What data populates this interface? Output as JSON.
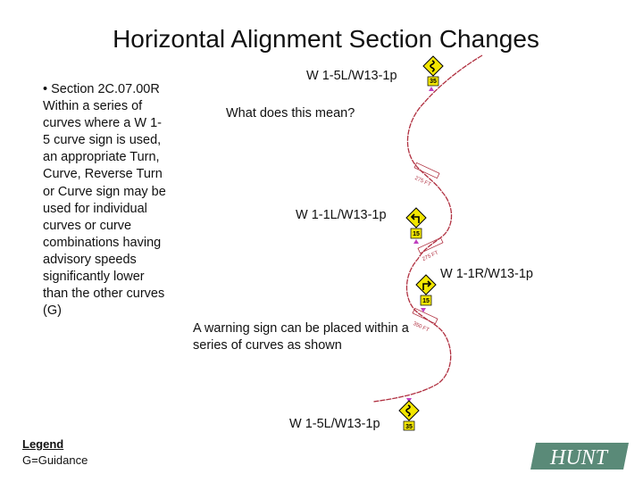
{
  "title": "Horizontal Alignment Section Changes",
  "bullet": "• Section 2C.07.00R Within a series of curves where a W 1-5 curve sign is used, an appropriate Turn, Curve, Reverse Turn or Curve sign may be used for individual curves or curve combinations having advisory speeds significantly lower than the other curves (G)",
  "labels": {
    "top_sign": "W 1-5L/W13-1p",
    "question": "What does this mean?",
    "middle_sign": "W 1-1L/W13-1p",
    "right_sign": "W 1-1R/W13-1p",
    "answer": "A warning sign can be placed within a series of curves as shown",
    "bottom_sign": "W 1-5L/W13-1p"
  },
  "signs": [
    {
      "icon": "winding-road-icon",
      "speed": "35"
    },
    {
      "icon": "turn-left-icon",
      "speed": "15"
    },
    {
      "icon": "turn-right-icon",
      "speed": "15"
    },
    {
      "icon": "winding-road-icon",
      "speed": "35"
    }
  ],
  "distances": [
    "275 FT",
    "275 FT",
    "350 FT"
  ],
  "legend": {
    "heading": "Legend",
    "item": "G=Guidance"
  },
  "logo": "HUNT",
  "colors": {
    "road": "#b03040",
    "sign": "#f2e600",
    "logo": "#5a8a78"
  }
}
